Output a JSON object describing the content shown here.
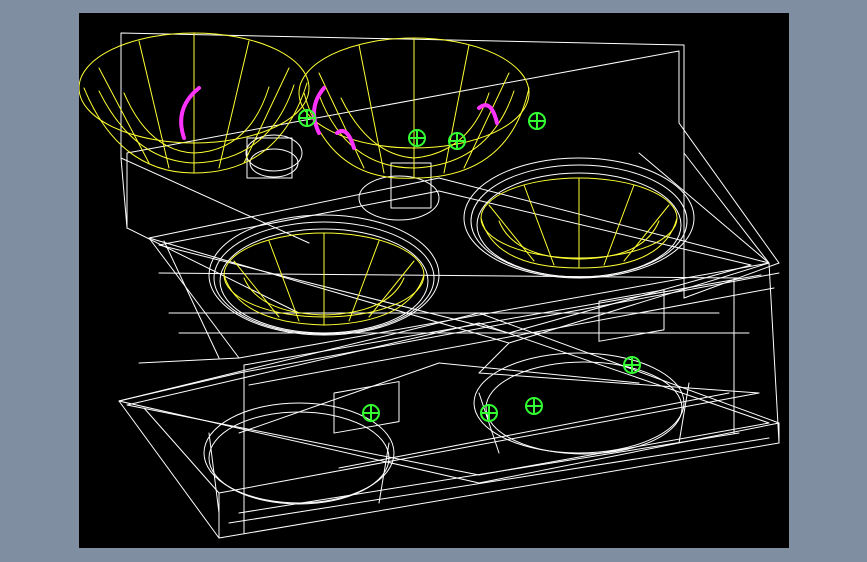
{
  "window": {
    "background_color": "#7f8ea0"
  },
  "viewport": {
    "background_color": "#000000",
    "render_mode": "wireframe",
    "wire_colors": {
      "edges": "#ffffff",
      "reflector_bowls": "#ffff33",
      "arc_markers": "#ff33ff",
      "fasteners": "#33ff33"
    },
    "icons": [
      "reflector-bowl-icon",
      "arrow-arc-icon",
      "fastener-icon"
    ]
  }
}
